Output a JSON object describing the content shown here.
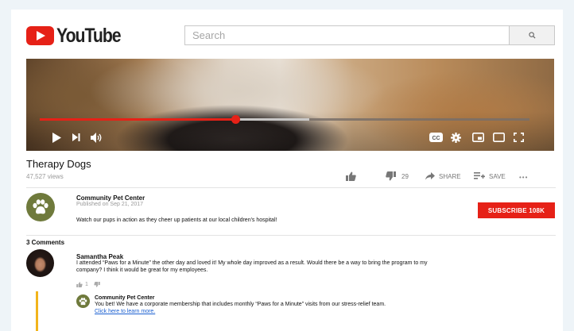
{
  "header": {
    "logo_text": "YouTube",
    "search_placeholder": "Search",
    "search_value": ""
  },
  "player": {
    "progress_played": 0.4,
    "progress_buffered": 0.55,
    "icons": [
      "play-icon",
      "next-icon",
      "volume-icon",
      "captions-icon",
      "settings-icon",
      "miniplayer-icon",
      "theater-icon",
      "fullscreen-icon"
    ],
    "captions_label": "CC"
  },
  "video": {
    "title": "Therapy Dogs",
    "views": "47,527 views",
    "dislike_count": "29",
    "share_label": "SHARE",
    "save_label": "SAVE",
    "more_label": "•••"
  },
  "channel": {
    "name": "Community Pet Center",
    "published": "Published on Sep 21, 2017",
    "description": "Watch our pups in action as they cheer up patients at our local children's hospital!",
    "subscribe_label": "SUBSCRIBE 108K"
  },
  "comments": {
    "count_label": "3 Comments",
    "items": [
      {
        "author": "Samantha Peak",
        "text": "I attended “Paws for a Minute” the other day and loved it! My whole day improved as a result. Would there be a way to bring the program to my company? I think it would be great for my employees.",
        "likes": "1",
        "reply": {
          "author": "Community Pet Center",
          "text": "You bet! We have a corporate membership that includes monthly “Paws for a Minute” visits from our stress-relief team.",
          "link_text": "Click here to learn more."
        }
      }
    ]
  },
  "colors": {
    "brand_red": "#e62117",
    "channel_green": "#6f7a3c",
    "reply_accent": "#f2b41b",
    "link_blue": "#1a5fd1"
  }
}
